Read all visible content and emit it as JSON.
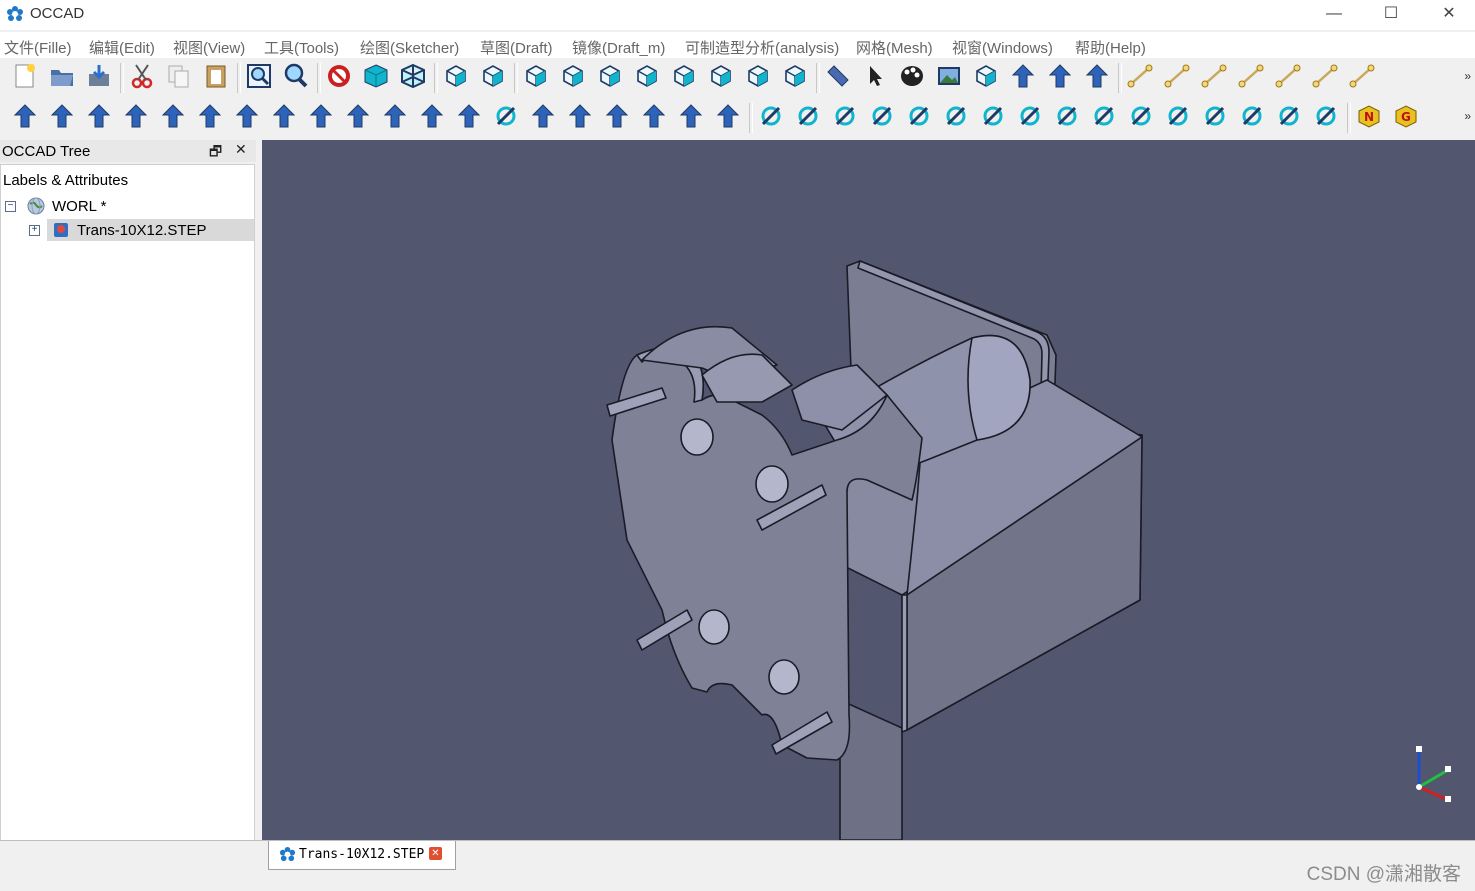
{
  "app": {
    "title": "OCCAD"
  },
  "window_controls": {
    "minimize": "—",
    "maximize": "☐",
    "close": "✕"
  },
  "menus": [
    {
      "label": "文件(Fille)"
    },
    {
      "label": "编辑(Edit)"
    },
    {
      "label": "视图(View)"
    },
    {
      "label": "工具(Tools)"
    },
    {
      "label": "绘图(Sketcher)"
    },
    {
      "label": "草图(Draft)"
    },
    {
      "label": "镜像(Draft_m)"
    },
    {
      "label": "可制造型分析(analysis)"
    },
    {
      "label": "网格(Mesh)"
    },
    {
      "label": "视窗(Windows)"
    },
    {
      "label": "帮助(Help)"
    }
  ],
  "toolbar_more": "»",
  "toolbar1_icons": [
    "new-icon",
    "open-icon",
    "save-icon",
    "cut-icon",
    "copy-icon",
    "paste-icon",
    "zoom-fit-icon",
    "zoom-icon",
    "no-selection-icon",
    "shaded-box-icon",
    "wireframe-box-icon",
    "iso-view-icon",
    "points-view-icon",
    "cube-view-icon",
    "front-view-icon",
    "top-view-icon",
    "right-view-icon",
    "left-view-icon",
    "rear-view-icon",
    "bottom-view-icon",
    "side-view-icon",
    "measure-icon",
    "pointer-icon",
    "color-palette-icon",
    "image-icon",
    "rotate-view-icon",
    "visibility-icon",
    "hide-icon",
    "push-pin-icon",
    "line-icon",
    "polyline-icon",
    "circle-icon",
    "arc-icon",
    "ellipse-icon",
    "polygon-icon",
    "rectangle-icon"
  ],
  "toolbar2_icons": [
    "move-icon",
    "rotate-icon",
    "offset-icon",
    "stretch-icon",
    "arrow-up-icon",
    "arrow-down-icon",
    "scale-icon",
    "trim-icon",
    "wire-icon",
    "upgrade-icon",
    "downgrade-icon",
    "shape-icon",
    "array-icon",
    "grid-array-icon",
    "path-array-icon",
    "clone-icon",
    "extrude-icon",
    "mirror-icon",
    "shape2d-icon",
    "lift-icon",
    "grid-icon",
    "lock-icon",
    "snap-endpoint-icon",
    "snap-extension-icon",
    "snap-parallel-icon",
    "snap-grid-icon",
    "snap-midpoint-icon",
    "snap-nearest-icon",
    "snap-perpendicular-icon",
    "snap-special-icon",
    "snap-center-icon",
    "snap-ortho-icon",
    "snap-intersection-icon",
    "working-plane-icon",
    "dimension-icon",
    "snap-toggle-icon",
    "mesh-n-icon",
    "mesh-g-icon"
  ],
  "colors": {
    "viewport_bg": "#53566f",
    "model_fill": "#7f8197",
    "model_light": "#a4a6bf",
    "model_dark": "#5e6077",
    "tool_cyan": "#10b4cc",
    "tool_dark": "#1f3a66"
  },
  "tree": {
    "dock_title": "OCCAD Tree",
    "dock_float_glyph": "🗗",
    "dock_close_glyph": "✕",
    "header": "Labels & Attributes",
    "root": {
      "label": "WORL *",
      "expander": "−"
    },
    "child": {
      "label": "Trans-10X12.STEP",
      "expander": "+"
    }
  },
  "document_tab": {
    "label": "Trans-10X12.STEP",
    "close_glyph": "✕"
  },
  "watermark": "CSDN @潇湘散客"
}
